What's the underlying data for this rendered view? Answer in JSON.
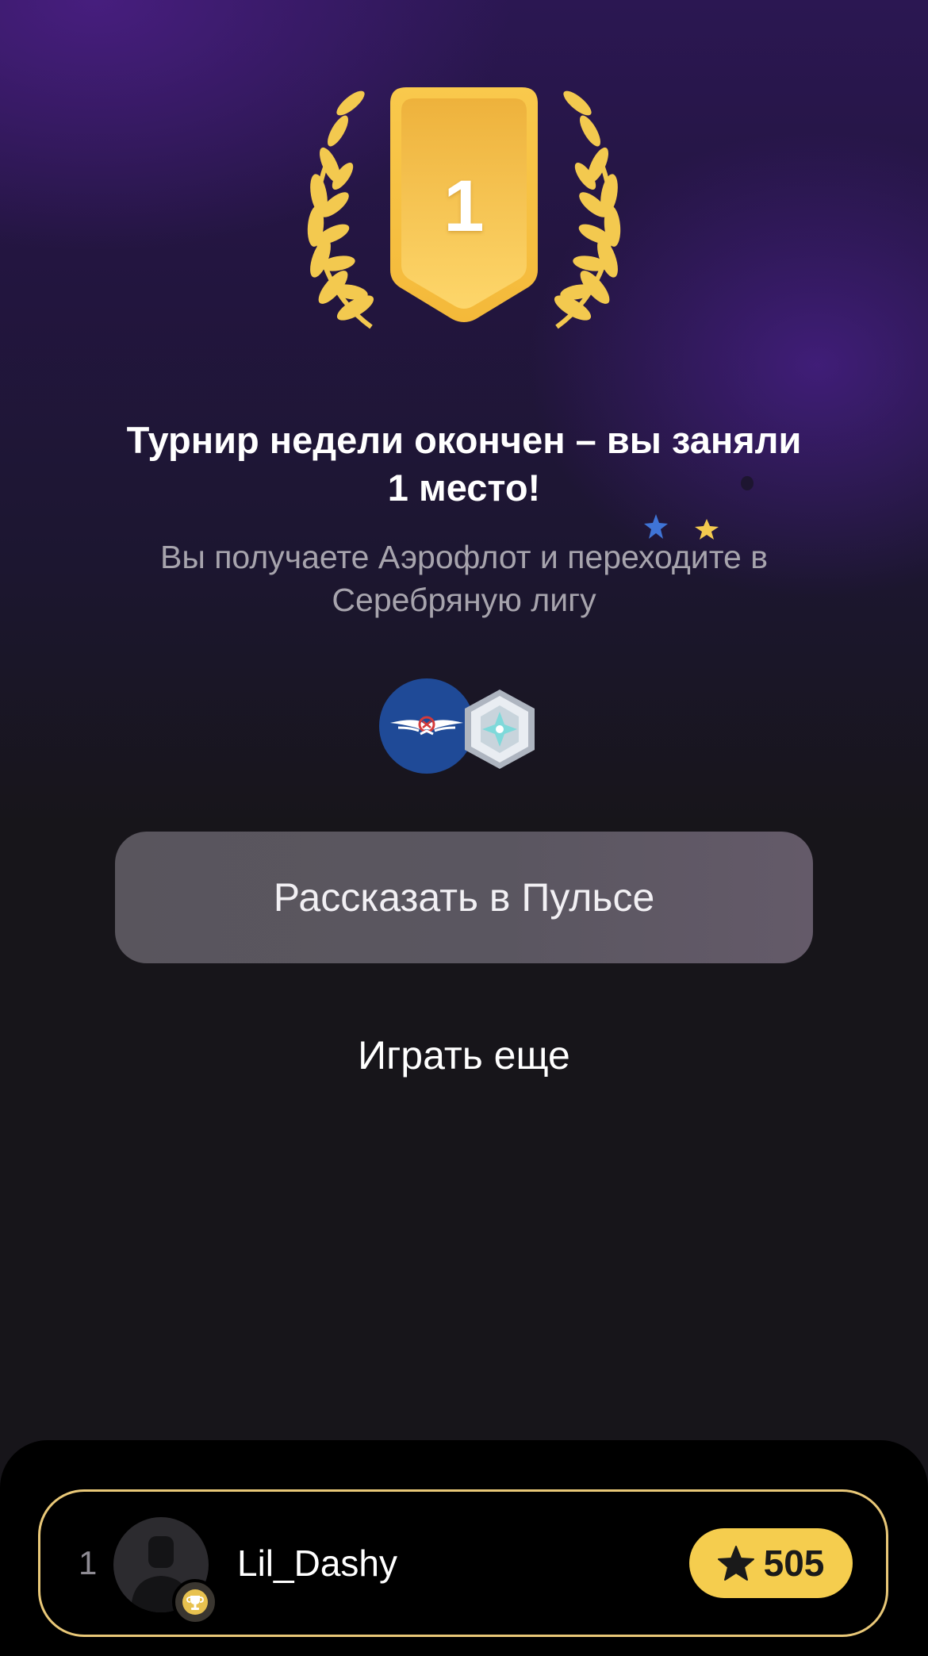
{
  "result": {
    "place": "1",
    "title": "Турнир недели окончен – вы заняли 1 место!",
    "subtitle": "Вы получаете Аэрофлот и переходите в Серебряную лигу"
  },
  "rewards": {
    "items": [
      {
        "icon": "aeroflot-logo-icon",
        "color": "#1f4a97"
      },
      {
        "icon": "silver-league-badge-icon",
        "color": "#c9ced6"
      }
    ]
  },
  "actions": {
    "share_label": "Рассказать в Пульсе",
    "play_again_label": "Играть еще"
  },
  "leaderboard": {
    "my_row": {
      "rank": "1",
      "username": "Lil_Dashy",
      "score": "505",
      "score_icon": "star-icon",
      "badge_icon": "trophy-icon"
    }
  },
  "colors": {
    "gold": "#f5cd4e",
    "highlight_border": "#e9c878",
    "background": "#17151a",
    "purple_glow": "#4a208c"
  }
}
